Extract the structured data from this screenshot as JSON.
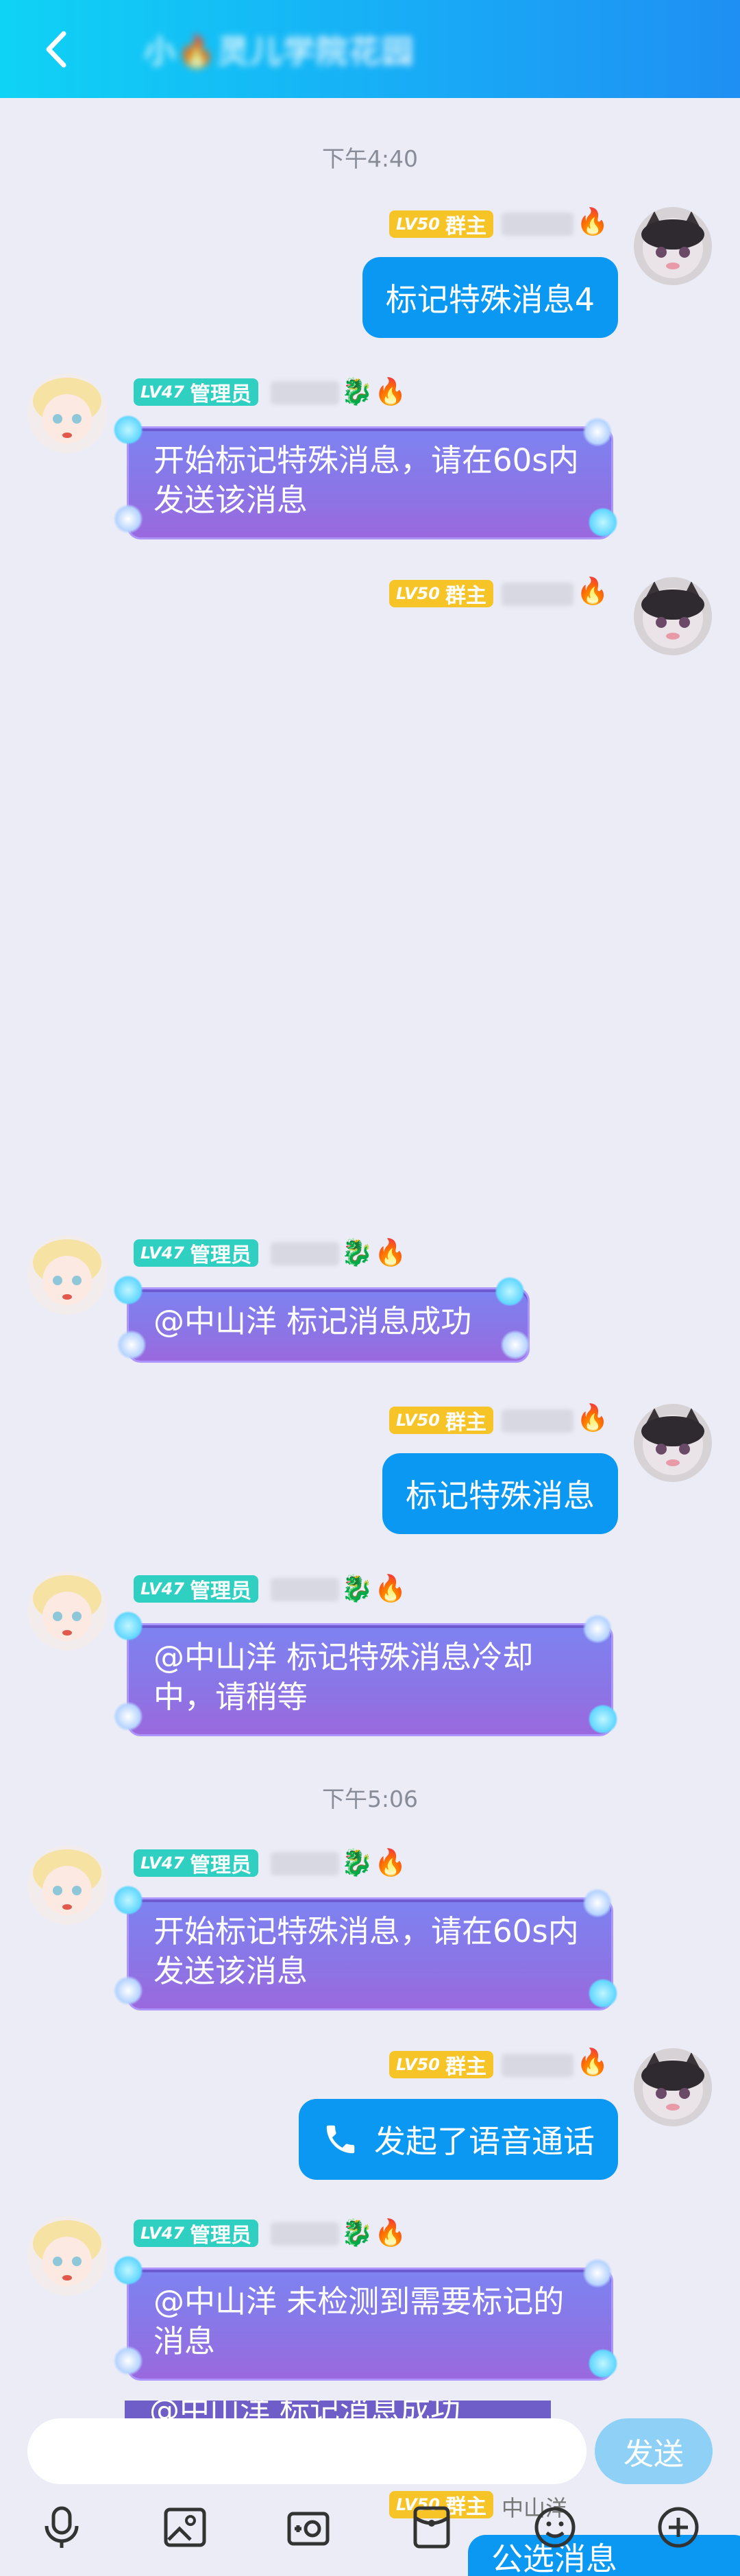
{
  "header": {
    "back_icon": "chevron-left-icon",
    "title": "小🔥灵儿学院花园",
    "accent_gradient": [
      "#0fd3f5",
      "#1f8ff3"
    ]
  },
  "times": [
    "下午4:40",
    "下午5:06"
  ],
  "roles": {
    "owner_level": "LV50",
    "owner_role": "群主",
    "admin_level": "LV47",
    "admin_role": "管理员",
    "owner_color": "#f7c427",
    "admin_color": "#2fcfc2"
  },
  "messages": [
    {
      "side": "right",
      "text": "标记特殊消息4"
    },
    {
      "side": "left",
      "text": "开始标记特殊消息，请在60s内发送该消息"
    },
    {
      "side": "left",
      "text": "@中山洋  标记消息成功"
    },
    {
      "side": "right",
      "text": "标记特殊消息"
    },
    {
      "side": "left",
      "text": "@中山洋  标记特殊消息冷却中，请稍等"
    },
    {
      "side": "left",
      "text": "开始标记特殊消息，请在60s内发送该消息"
    },
    {
      "side": "right",
      "text": "发起了语音通话",
      "icon": "phone-icon"
    },
    {
      "side": "left",
      "text": "@中山洋  未检测到需要标记的消息"
    }
  ],
  "partial_message": "@中山洋  标记消息成功",
  "input": {
    "placeholder": "",
    "send_label": "发送"
  },
  "toolbar": {
    "icons": [
      "microphone-icon",
      "image-icon",
      "camera-icon",
      "red-packet-icon",
      "emoji-icon",
      "more-icon"
    ]
  },
  "peek": {
    "name": "中山洋",
    "bubble_text": "公选消息"
  }
}
